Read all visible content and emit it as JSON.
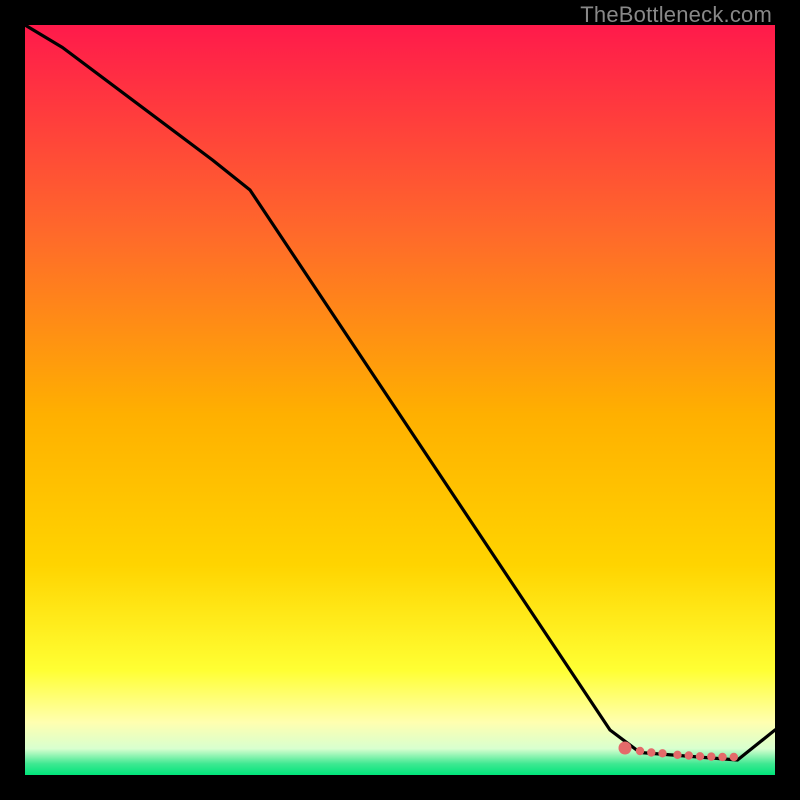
{
  "watermark": "TheBottleneck.com",
  "colors": {
    "gradient_top": "#ff1a4b",
    "gradient_mid1": "#ff7a2a",
    "gradient_mid2": "#ffd400",
    "gradient_yellow": "#ffff33",
    "gradient_lightyellow": "#ffffb0",
    "gradient_green": "#00e57a",
    "line": "#000000",
    "marker": "#e46a6a",
    "frame": "#000000"
  },
  "chart_data": {
    "type": "line",
    "title": "",
    "xlabel": "",
    "ylabel": "",
    "xlim": [
      0,
      100
    ],
    "ylim": [
      0,
      100
    ],
    "grid": false,
    "series": [
      {
        "name": "bottleneck-curve",
        "x": [
          0,
          5,
          25,
          30,
          78,
          82,
          95,
          100
        ],
        "y": [
          100,
          97,
          82,
          78,
          6,
          3,
          2,
          6
        ]
      }
    ],
    "markers": {
      "name": "highlight-dots",
      "x": [
        80,
        82,
        83.5,
        85,
        87,
        88.5,
        90,
        91.5,
        93,
        94.5
      ],
      "y": [
        3.6,
        3.2,
        3.0,
        2.9,
        2.7,
        2.6,
        2.5,
        2.45,
        2.4,
        2.4
      ]
    },
    "annotations": []
  }
}
